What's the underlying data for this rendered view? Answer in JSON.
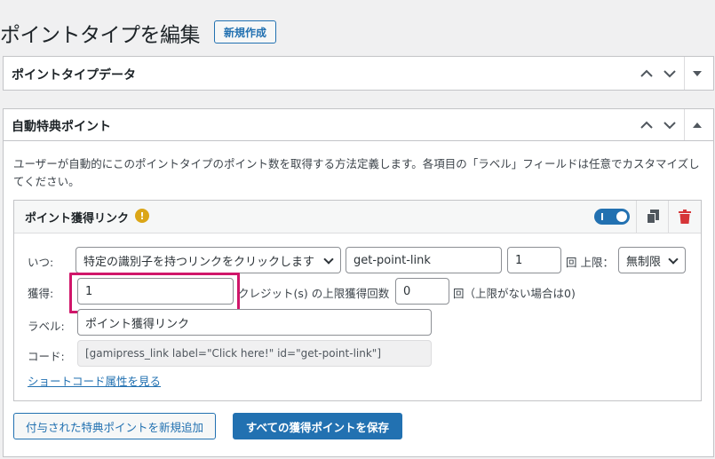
{
  "header": {
    "title": "ポイントタイプを編集",
    "new_button": "新規作成"
  },
  "box_point_type_data": {
    "title": "ポイントタイプデータ"
  },
  "box_auto_award": {
    "title": "自動特典ポイント",
    "description": "ユーザーが自動的にこのポイントタイプのポイント数を取得する方法定義します。各項目の「ラベル」フィールドは任意でカスタマイズしてください。",
    "requirement": {
      "title": "ポイント獲得リンク",
      "warning_symbol": "!",
      "when_label": "いつ:",
      "trigger_value": "特定の識別子を持つリンクをクリックします",
      "link_id_value": "get-point-link",
      "times_value": "1",
      "times_suffix": "回 上限：",
      "limit_value": "無制限",
      "earn_label": "獲得:",
      "points_value": "1",
      "credits_text": "クレジット(s) の上限獲得回数",
      "max_earnings_value": "0",
      "max_earnings_suffix": "回（上限がない場合は0)",
      "label_label": "ラベル:",
      "label_value": "ポイント獲得リンク",
      "code_label": "コード:",
      "code_value": "[gamipress_link label=\"Click here!\" id=\"get-point-link\"]",
      "shortcode_link": "ショートコード属性を見る"
    },
    "add_button": "付与された特典ポイントを新規追加",
    "save_button": "すべての獲得ポイントを保存"
  },
  "colors": {
    "accent": "#2271b1",
    "highlight": "#d0166a",
    "delete": "#d63638",
    "warning": "#dba617"
  }
}
